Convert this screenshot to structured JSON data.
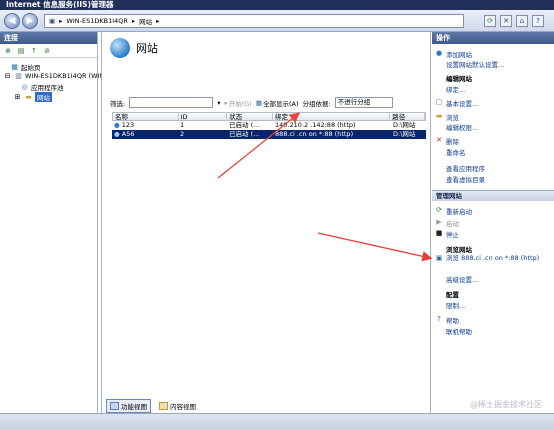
{
  "window": {
    "title": "Internet 信息服务(IIS)管理器"
  },
  "address": {
    "segments": [
      "WIN-ES1DKB1I4QR",
      "网站"
    ]
  },
  "connections": {
    "header": "连接",
    "tree": [
      {
        "label": "起始页",
        "icon": "start-page-icon"
      },
      {
        "label": "WIN-ES1DKB1I4QR (WIN",
        "icon": "server-icon"
      },
      {
        "label": "应用程序池",
        "icon": "app-pool-icon"
      },
      {
        "label": "网站",
        "icon": "sites-folder-icon"
      }
    ]
  },
  "main": {
    "title": "网站",
    "filter": {
      "label": "筛选:",
      "start_btn": "开始(G)",
      "show_all_btn": "全部显示(A)",
      "group_label": "分组依据:",
      "group_value": "不进行分组"
    },
    "columns": [
      "名称",
      "ID",
      "状态",
      "绑定",
      "路径"
    ],
    "rows": [
      {
        "name": "123",
        "id": "1",
        "state": "已启动 (...",
        "binding": "140.210.2 .142:88 (http)",
        "path": "D:\\网站"
      },
      {
        "name": "A56",
        "id": "2",
        "state": "已启动 (...",
        "binding": "888.ci     .cn on *:88 (http)",
        "path": "D:\\网站"
      }
    ],
    "tabs": {
      "features": "功能视图",
      "content": "内容视图"
    }
  },
  "actions": {
    "header": "操作",
    "items": [
      {
        "label": "添加网站",
        "icon": "add-site-icon"
      },
      {
        "label": "设置网站默认设置...",
        "icon": ""
      },
      {
        "label": "编辑网站",
        "bold": true
      },
      {
        "label": "绑定...",
        "icon": ""
      },
      {
        "label": "基本设置...",
        "icon": "settings-icon"
      },
      {
        "label": "浏览",
        "icon": "explore-icon"
      },
      {
        "label": "编辑权限...",
        "icon": ""
      },
      {
        "label": "删除",
        "icon": "delete-icon"
      },
      {
        "label": "重命名",
        "icon": ""
      },
      {
        "label": "查看应用程序",
        "icon": ""
      },
      {
        "label": "查看虚拟目录",
        "icon": ""
      }
    ],
    "manage_header": "管理网站",
    "manage_items": [
      {
        "label": "重新启动",
        "icon": "restart-icon"
      },
      {
        "label": "启动",
        "icon": "start-icon",
        "disabled": true
      },
      {
        "label": "停止",
        "icon": "stop-icon"
      }
    ],
    "browse_header": "浏览网站",
    "browse_item": "浏览 888.ci      .cn on *:88 (http)",
    "advanced": "高级设置...",
    "config_header": "配置",
    "limits": "限制...",
    "help": "帮助",
    "online_help": "联机帮助"
  },
  "watermark": "@稀土掘金技术社区",
  "colors": {
    "selection": "#0a246a",
    "arrow": "#e8413a",
    "pane_header": "#3e5889"
  }
}
